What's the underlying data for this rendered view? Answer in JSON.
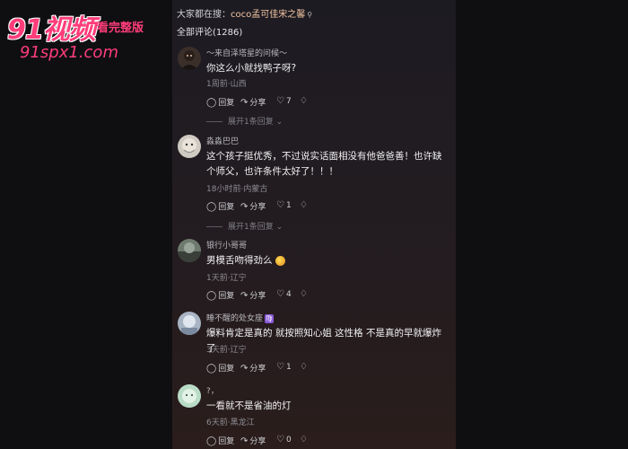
{
  "watermark": {
    "logo": "91视频",
    "subtitle": "看完整版",
    "url": "91spx1.com"
  },
  "search_hint": {
    "prefix": "大家都在搜：",
    "keyword": "coco孟可佳宋之馨"
  },
  "comment_count_label": "全部评论(1286)",
  "action_labels": {
    "reply": "回复",
    "share": "分享"
  },
  "comments": [
    {
      "username": "～来自泽塔星的问候～",
      "text": "你这么小就找鸭子呀?",
      "meta": "1周前·山西",
      "likes": "7",
      "expand": "展开1条回复"
    },
    {
      "username": "淼淼巴巴",
      "text": "这个孩子挺优秀，不过说实话面相没有他爸爸善！也许缺个师父，也许条件太好了！！！",
      "meta": "18小时前·内蒙古",
      "likes": "1",
      "expand": "展开1条回复"
    },
    {
      "username": "银行小哥哥",
      "text": "男模舌吻得劲么",
      "meta": "1天前·辽宁",
      "likes": "4"
    },
    {
      "username": "睡不醒的处女座",
      "text": "爆料肯定是真的 就按照知心姐 这性格 不是真的早就爆炸了",
      "meta": "3天前·辽宁",
      "likes": "1"
    },
    {
      "username": "?，",
      "text": "一看就不是省油的灯",
      "meta": "6天前·黑龙江",
      "likes": "0"
    }
  ],
  "colors": {
    "panel_bg": "#1f1b21",
    "watermark": "#ff3d7a",
    "keyword": "#f2c6a2"
  }
}
